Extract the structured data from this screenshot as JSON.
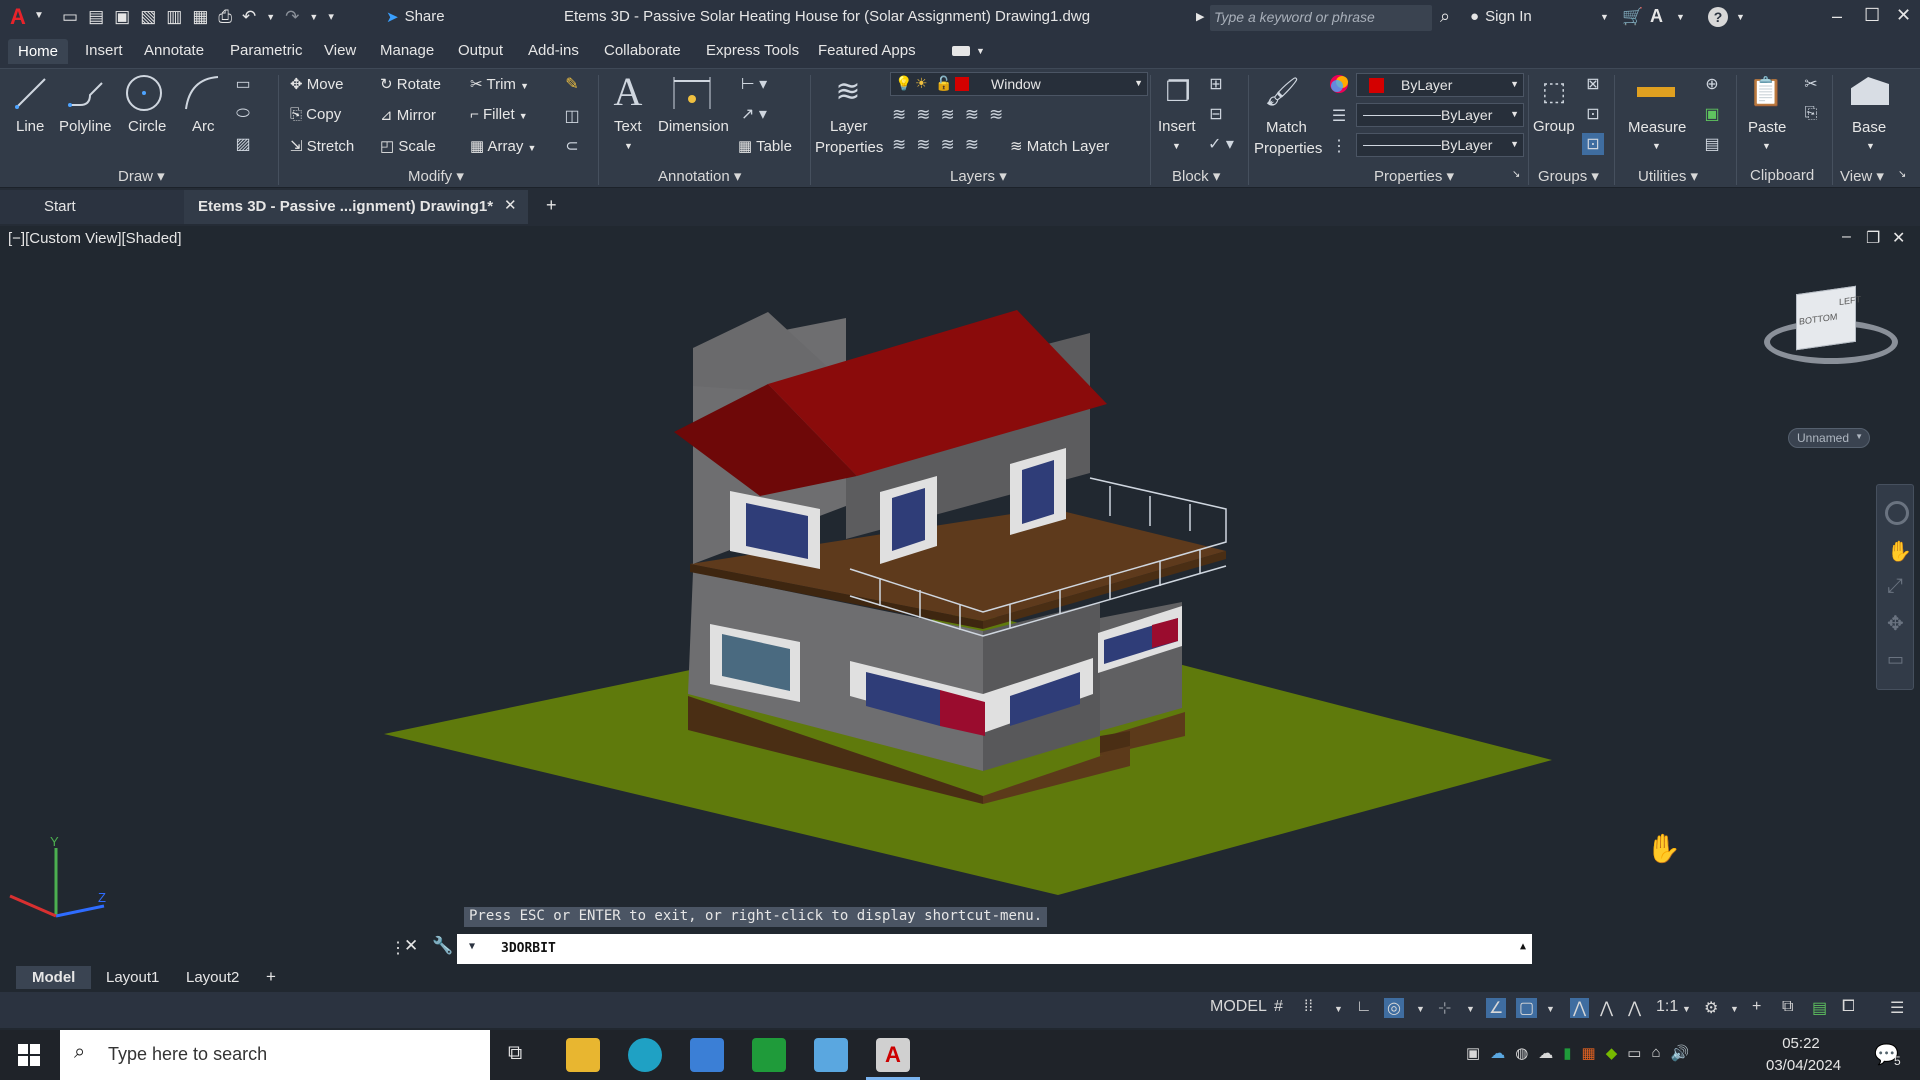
{
  "title_bar": {
    "app_logo": "A",
    "share_label": "Share",
    "title": "Etems 3D - Passive Solar Heating House for (Solar Assignment)  Drawing1.dwg",
    "search_placeholder": "Type a keyword or phrase",
    "sign_in": "Sign In"
  },
  "ribbon_tabs": [
    "Home",
    "Insert",
    "Annotate",
    "Parametric",
    "View",
    "Manage",
    "Output",
    "Add-ins",
    "Collaborate",
    "Express Tools",
    "Featured Apps"
  ],
  "ribbon": {
    "draw": {
      "title": "Draw",
      "line": "Line",
      "polyline": "Polyline",
      "circle": "Circle",
      "arc": "Arc"
    },
    "modify": {
      "title": "Modify",
      "move": "Move",
      "rotate": "Rotate",
      "trim": "Trim",
      "copy": "Copy",
      "mirror": "Mirror",
      "fillet": "Fillet",
      "stretch": "Stretch",
      "scale": "Scale",
      "array": "Array"
    },
    "annotation": {
      "title": "Annotation",
      "text": "Text",
      "dimension": "Dimension",
      "table": "Table"
    },
    "layers": {
      "title": "Layers",
      "layer_properties_1": "Layer",
      "layer_properties_2": "Properties",
      "current_layer": "Window",
      "match_layer": "Match Layer"
    },
    "block": {
      "title": "Block",
      "insert": "Insert"
    },
    "properties": {
      "title": "Properties",
      "match_1": "Match",
      "match_2": "Properties",
      "color": "ByLayer",
      "linetype": "ByLayer",
      "lineweight": "ByLayer"
    },
    "groups": {
      "title": "Groups",
      "group": "Group"
    },
    "utilities": {
      "title": "Utilities",
      "measure": "Measure"
    },
    "clipboard": {
      "title": "Clipboard",
      "paste": "Paste"
    },
    "view": {
      "title": "View",
      "base": "Base"
    }
  },
  "doc_tabs": {
    "start": "Start",
    "active": "Etems 3D - Passive ...ignment)  Drawing1*"
  },
  "viewport": {
    "label": "[−][Custom View][Shaded]",
    "viewcube_top": "BOTTOM",
    "viewcube_side": "LEFT",
    "view_name": "Unnamed",
    "axis_y": "Y",
    "axis_z": "Z"
  },
  "command": {
    "hint": "Press ESC or ENTER to exit, or right-click to display shortcut-menu.",
    "current": "3DORBIT"
  },
  "layout_tabs": [
    "Model",
    "Layout1",
    "Layout2"
  ],
  "status": {
    "model": "MODEL",
    "scale": "1:1"
  },
  "taskbar": {
    "search_placeholder": "Type here to search",
    "time": "05:22",
    "date": "03/04/2024",
    "notifications": "5"
  },
  "colors": {
    "roof": "#8a0b0b",
    "ground": "#5f7a0c",
    "wall": "#6e6e70",
    "accent_red": "#d40000"
  }
}
